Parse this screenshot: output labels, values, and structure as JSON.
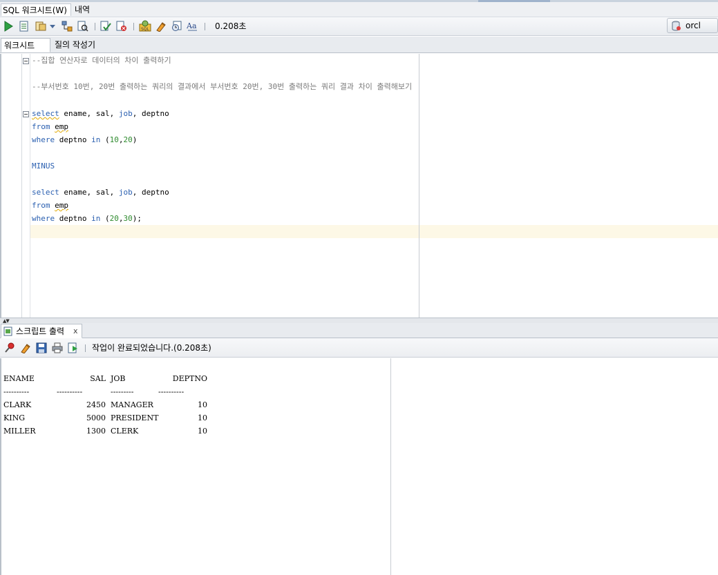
{
  "menu": {
    "worksheet_tab": "SQL 워크시트(W)",
    "history_tab": "내역"
  },
  "toolbar": {
    "elapsed": "0.208초",
    "connection": "orcl",
    "icons": [
      "run-statement-icon",
      "run-script-icon",
      "autotrace-icon",
      "dropdown-arrow-icon",
      "explain-plan-icon",
      "sql-tuning-icon",
      "commit-icon",
      "rollback-icon",
      "sql-history-icon",
      "clear-icon",
      "unshared-worksheet-icon",
      "format-icon"
    ]
  },
  "editor_tabs": {
    "worksheet": "워크시트",
    "query_builder": "질의 작성기"
  },
  "editor": {
    "lines": [
      "--집합 연산자로 데이터의 차이 출력하기",
      "--부서번호 10번, 20번 출력하는 쿼리의 결과에서 부서번호 20번, 30번 출력하는 쿼리 결과 차이 출력해보기",
      "select ename, sal, job, deptno",
      "from emp",
      "where deptno in (10,20)",
      "MINUS",
      "select ename, sal, job, deptno",
      "from emp",
      "where deptno in (20,30);"
    ]
  },
  "output": {
    "tab_label": "스크립트 출력",
    "close_label": "x",
    "status": "작업이 완료되었습니다.(0.208초)",
    "icons": [
      "pin-icon",
      "clear-output-icon",
      "save-icon",
      "print-icon",
      "export-icon"
    ],
    "headers": [
      "ENAME",
      "SAL",
      "JOB",
      "DEPTNO"
    ],
    "separator": [
      "----------",
      "----------",
      "---------",
      "----------"
    ],
    "rows": [
      [
        "CLARK",
        "2450",
        "MANAGER",
        "10"
      ],
      [
        "KING",
        "5000",
        "PRESIDENT",
        "10"
      ],
      [
        "MILLER",
        "1300",
        "CLERK",
        "10"
      ]
    ]
  },
  "colors": {
    "keyword": "#2a5fb0",
    "comment": "#7a7a7a",
    "number": "#2e8b2e",
    "current_line": "#fdf8e6"
  }
}
